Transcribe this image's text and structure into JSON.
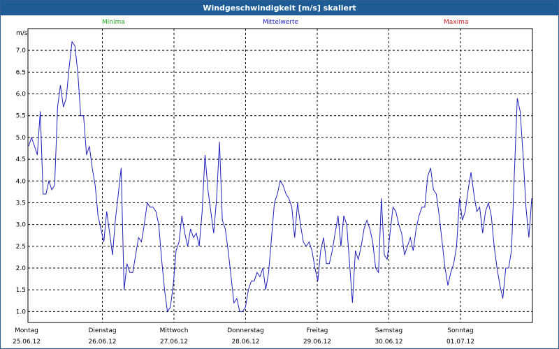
{
  "window": {
    "title": "Windgeschwindigkeit [m/s] skaliert"
  },
  "legend": {
    "minima": {
      "label": "Minima",
      "color": "#22aa22"
    },
    "mean": {
      "label": "Mittelwerte",
      "color": "#2020c0"
    },
    "maxima": {
      "label": "Maxima",
      "color": "#c02020"
    }
  },
  "chart_data": {
    "type": "line",
    "title": "Windgeschwindigkeit [m/s] skaliert",
    "ylabel": "m/s",
    "xlabel": "",
    "ylim": [
      0.75,
      7.5
    ],
    "yticks": [
      "1.0",
      "1.5",
      "2.0",
      "2.5",
      "3.0",
      "3.5",
      "4.0",
      "4.5",
      "5.0",
      "5.5",
      "6.0",
      "6.5",
      "7.0"
    ],
    "days": [
      {
        "name": "Montag",
        "date": "25.06.12"
      },
      {
        "name": "Dienstag",
        "date": "26.06.12"
      },
      {
        "name": "Mittwoch",
        "date": "27.06.12"
      },
      {
        "name": "Donnerstag",
        "date": "28.06.12"
      },
      {
        "name": "Freitag",
        "date": "29.06.12"
      },
      {
        "name": "Samstag",
        "date": "30.06.12"
      },
      {
        "name": "Sonntag",
        "date": "01.07.12"
      }
    ],
    "grid": true,
    "series": [
      {
        "name": "Mittelwerte",
        "color": "#2020c0",
        "values": [
          4.8,
          5.0,
          4.8,
          4.6,
          5.6,
          3.7,
          3.7,
          4.0,
          3.8,
          3.9,
          5.7,
          6.2,
          5.7,
          5.9,
          6.6,
          7.2,
          7.1,
          6.5,
          5.5,
          5.5,
          4.6,
          4.8,
          4.3,
          3.9,
          3.2,
          2.9,
          2.6,
          3.3,
          2.8,
          2.3,
          3.1,
          3.7,
          4.3,
          1.5,
          2.1,
          1.9,
          1.9,
          2.3,
          2.7,
          2.6,
          3.0,
          3.5,
          3.4,
          3.4,
          3.3,
          3.0,
          2.2,
          1.5,
          1.0,
          1.1,
          1.6,
          2.4,
          2.6,
          3.2,
          2.8,
          2.5,
          2.9,
          2.7,
          2.8,
          2.5,
          3.3,
          4.6,
          3.8,
          3.3,
          2.8,
          3.6,
          4.9,
          3.1,
          2.9,
          2.4,
          1.8,
          1.2,
          1.3,
          1.0,
          1.0,
          1.1,
          1.5,
          1.7,
          1.7,
          1.9,
          1.8,
          2.0,
          1.5,
          1.9,
          2.7,
          3.5,
          3.7,
          4.0,
          3.9,
          3.7,
          3.6,
          3.4,
          2.7,
          3.5,
          3.0,
          2.6,
          2.5,
          2.6,
          2.4,
          2.0,
          1.7,
          2.4,
          2.7,
          2.1,
          2.1,
          2.4,
          2.8,
          3.2,
          2.5,
          3.2,
          3.0,
          2.1,
          1.2,
          2.4,
          2.2,
          2.5,
          2.9,
          3.1,
          2.9,
          2.6,
          2.0,
          1.9,
          3.6,
          2.3,
          2.2,
          2.8,
          3.4,
          3.3,
          3.0,
          2.8,
          2.3,
          2.5,
          2.7,
          2.4,
          2.9,
          3.2,
          3.4,
          3.4,
          4.1,
          4.3,
          3.8,
          3.7,
          3.2,
          2.6,
          2.0,
          1.6,
          1.9,
          2.1,
          2.5,
          3.6,
          3.1,
          3.3,
          3.8,
          4.2,
          3.7,
          3.3,
          3.4,
          2.8,
          3.3,
          3.5,
          3.2,
          2.5,
          2.0,
          1.6,
          1.3,
          2.0,
          2.0,
          2.4,
          4.2,
          5.9,
          5.6,
          4.6,
          3.4,
          2.7,
          3.6
        ]
      }
    ]
  }
}
